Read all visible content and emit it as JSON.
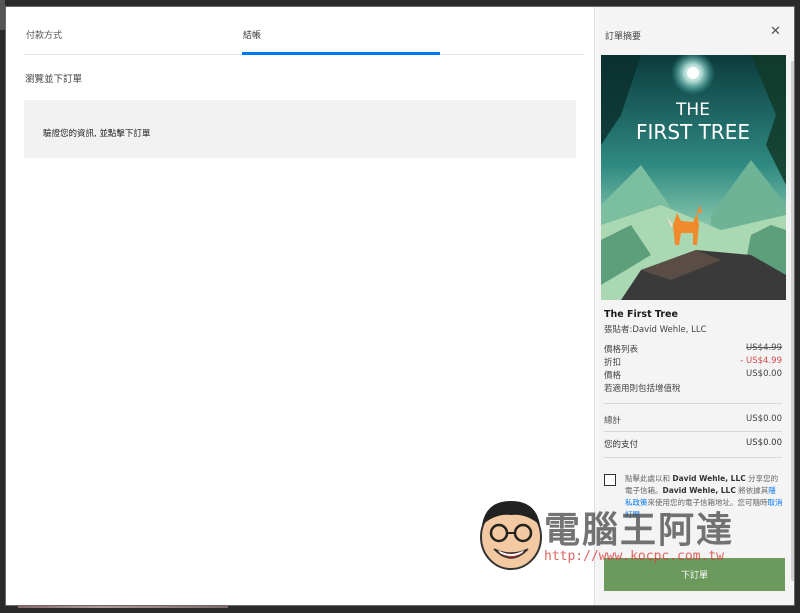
{
  "tabs": {
    "payment": "付款方式",
    "checkout": "結帳"
  },
  "main": {
    "section_title": "瀏覽並下訂單",
    "verify_text": "驗證您的資訊, 並點擊下訂單"
  },
  "summary": {
    "header": "訂單摘要",
    "close_icon": "close-icon",
    "cover_title_line1": "THE",
    "cover_title_line2": "FIRST TREE",
    "game_title": "The First Tree",
    "seller": "張貼者:David Wehle, LLC",
    "list_price_label": "價格列表",
    "list_price_value": "US$4.99",
    "discount_label": "折扣",
    "discount_value": "- US$4.99",
    "price_label": "價格",
    "price_value": "US$0.00",
    "tax_note": "若適用則包括增值稅",
    "total_label": "總計",
    "total_value": "US$0.00",
    "your_payment_label": "您的支付",
    "your_payment_value": "US$0.00",
    "consent_part1": "點擊此處以和 ",
    "consent_brand1": "David Wehle, LLC",
    "consent_part2": " 分享您的電子信箱。",
    "consent_brand2": "David Wehle, LLC",
    "consent_part3": " 將依據其",
    "consent_link1": "隱私政策",
    "consent_part4": "來使用您的電子信箱地址。",
    "consent_part5": "您",
    "consent_part6": "可",
    "consent_part7": "隨時",
    "consent_link2": "取消訂閱",
    "order_button": "下訂單"
  },
  "watermark": {
    "logo_text": "電腦王阿達",
    "url": "http://www.kocpc.com.tw"
  },
  "colors": {
    "accent": "#0078f2",
    "order_button": "#6b9a5c",
    "discount": "#d24b4b"
  }
}
